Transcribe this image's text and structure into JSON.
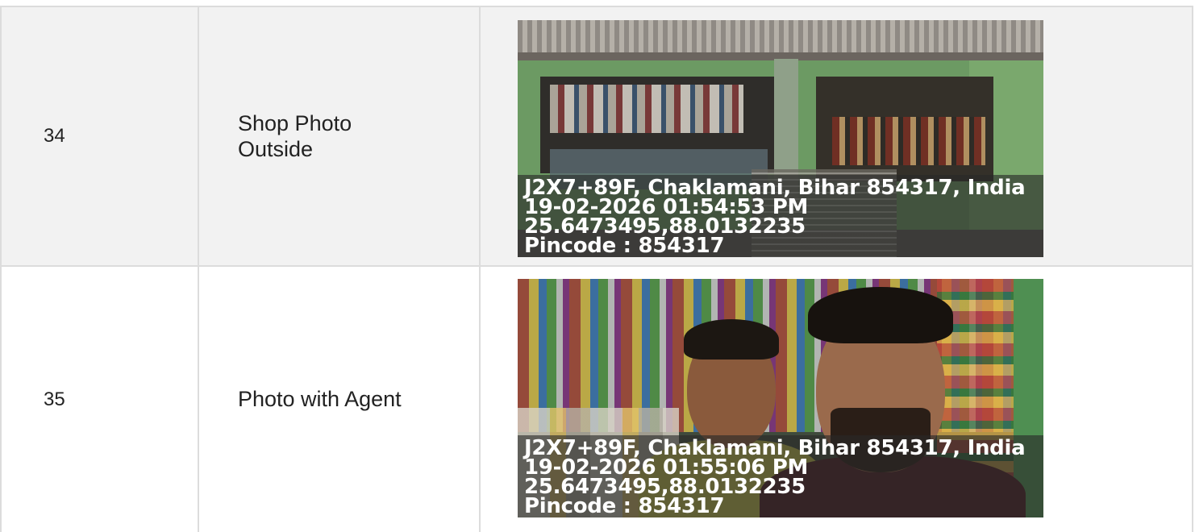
{
  "rows": [
    {
      "number": "34",
      "label": "Shop Photo Outside",
      "photo": {
        "address": "J2X7+89F, Chaklamani, Bihar 854317, India",
        "datetime": "19-02-2026 01:54:53 PM",
        "coordinates": "25.6473495,88.0132235",
        "pincode": "Pincode : 854317"
      }
    },
    {
      "number": "35",
      "label": "Photo with Agent",
      "photo": {
        "address": "J2X7+89F, Chaklamani, Bihar 854317, India",
        "datetime": "19-02-2026 01:55:06 PM",
        "coordinates": "25.6473495,88.0132235",
        "pincode": "Pincode : 854317"
      }
    }
  ]
}
